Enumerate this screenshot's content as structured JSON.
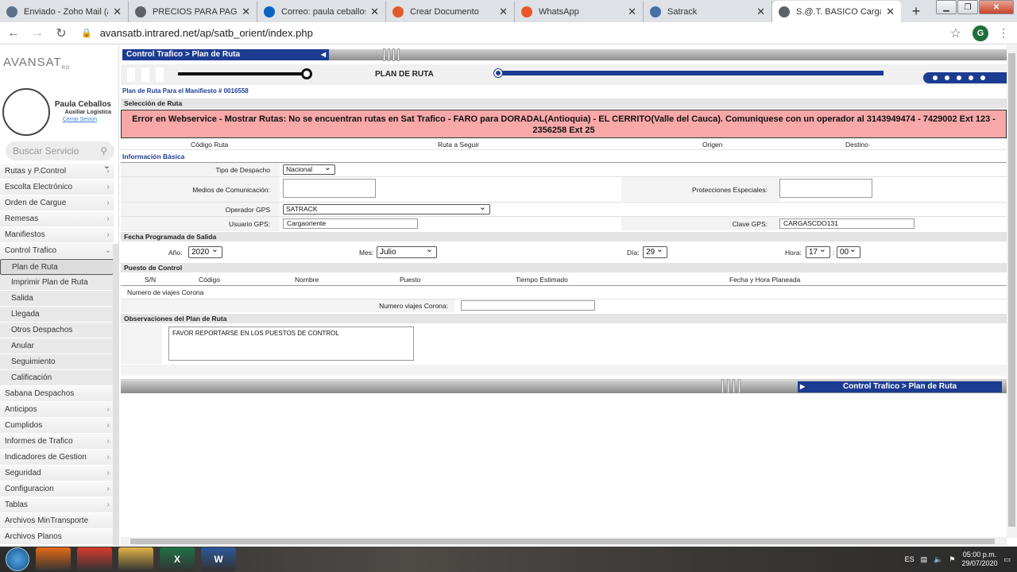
{
  "tabs": [
    {
      "title": "Enviado - Zoho Mail (aux",
      "icon": "zoho-mail-icon",
      "color": "#5b6f8a"
    },
    {
      "title": "PRECIOS PARA PAGAR A",
      "icon": "globe-icon",
      "color": "#5f6368"
    },
    {
      "title": "Correo: paula ceballos - C",
      "icon": "outlook-icon",
      "color": "#0a64c2"
    },
    {
      "title": "Crear Documento",
      "icon": "document-icon",
      "color": "#e25a2c"
    },
    {
      "title": "WhatsApp",
      "icon": "whatsapp-icon",
      "color": "#e8582a"
    },
    {
      "title": "Satrack",
      "icon": "satrack-icon",
      "color": "#4a6fa5"
    },
    {
      "title": "S.@.T. BASICO Cargas de",
      "icon": "globe-icon",
      "color": "#5f6368"
    }
  ],
  "address": {
    "url": "avansatb.intrared.net/ap/satb_orient/index.php",
    "account_initial": "G"
  },
  "sidebar": {
    "logo": "AVANSAT",
    "logo_sup": "RD",
    "user_name": "Paula Ceballos",
    "user_role": "Auxiliar Logistica",
    "logout": "Cerrar Sesion",
    "search_placeholder": "Buscar Servicio",
    "items": [
      {
        "label": "Rutas y P.Control",
        "type": "item",
        "chev": "›"
      },
      {
        "label": "Escolta Electrónico",
        "type": "item",
        "chev": "›"
      },
      {
        "label": "Orden de Cargue",
        "type": "item",
        "chev": "›"
      },
      {
        "label": "Remesas",
        "type": "item",
        "chev": "›"
      },
      {
        "label": "Manifiestos",
        "type": "item",
        "chev": "›"
      },
      {
        "label": "Control Trafico",
        "type": "item",
        "chev": "⌄"
      },
      {
        "label": "Plan de Ruta",
        "type": "sub",
        "chev": ""
      },
      {
        "label": "Imprimir Plan de Ruta",
        "type": "sub",
        "chev": ""
      },
      {
        "label": "Salida",
        "type": "sub",
        "chev": ""
      },
      {
        "label": "Llegada",
        "type": "sub",
        "chev": ""
      },
      {
        "label": "Otros Despachos",
        "type": "sub",
        "chev": ""
      },
      {
        "label": "Anular",
        "type": "sub",
        "chev": ""
      },
      {
        "label": "Seguimiento",
        "type": "sub",
        "chev": ""
      },
      {
        "label": "Calificación",
        "type": "sub",
        "chev": ""
      },
      {
        "label": "Sabana Despachos",
        "type": "item",
        "chev": ""
      },
      {
        "label": "Anticipos",
        "type": "item",
        "chev": "›"
      },
      {
        "label": "Cumplidos",
        "type": "item",
        "chev": "›"
      },
      {
        "label": "Informes de Trafico",
        "type": "item",
        "chev": "›"
      },
      {
        "label": "Indicadores de Gestion",
        "type": "item",
        "chev": "›"
      },
      {
        "label": "Seguridad",
        "type": "item",
        "chev": "›"
      },
      {
        "label": "Configuracion",
        "type": "item",
        "chev": "›"
      },
      {
        "label": "Tablas",
        "type": "item",
        "chev": "›"
      },
      {
        "label": "Archivos MinTransporte",
        "type": "item",
        "chev": ""
      },
      {
        "label": "Archivos Planos",
        "type": "item",
        "chev": ""
      }
    ]
  },
  "main": {
    "breadcrumb": "Control Trafico > Plan de Ruta",
    "page_title": "PLAN DE RUTA",
    "manifest": "Plan de Ruta Para el Manifiesto # 0016558",
    "sec_route": "Selección de Ruta",
    "error": "Error en Webservice - Mostrar Rutas: No se encuentran rutas en Sat Trafico - FARO para DORADAL(Antioquia) - EL CERRITO(Valle del Cauca). Comuniquese con un operador al 3143949474 - 7429002 Ext 123 - 2356258 Ext 25",
    "route_cols": [
      "Código Ruta",
      "Ruta a Seguir",
      "Origen",
      "Destino"
    ],
    "sec_info": "Información Básica",
    "tipo_label": "Tipo de Despacho",
    "tipo_value": "Nacional",
    "medios_label": "Medios de Comunicación:",
    "prot_label": "Protecciones Especiales:",
    "operador_label": "Operador GPS",
    "operador_value": "SATRACK",
    "usuario_label": "Usuario GPS:",
    "usuario_value": "Cargaoriente",
    "clave_label": "Clave GPS:",
    "clave_value": "CARGASCDO131",
    "sec_fecha": "Fecha Programada de Salida",
    "anio_label": "Año:",
    "anio_value": "2020",
    "mes_label": "Mes:",
    "mes_value": "Julio",
    "dia_label": "Día:",
    "dia_value": "29",
    "hora_label": "Hora:",
    "hora_value": "17",
    "min_value": "00",
    "sec_puesto": "Puesto de Control",
    "puesto_cols": [
      "S/N",
      "Código",
      "Nombre",
      "Puesto",
      "Tiempo Estimado",
      "Fecha y Hora Planeada"
    ],
    "viajes_title": "Numero de viajes Corona",
    "viajes_label": "Numero viajes Corona:",
    "sec_obs": "Observaciones del Plan de Ruta",
    "obs_value": "FAVOR REPORTARSE EN LOS PUESTOS DE CONTROL",
    "footer_btn": "Control Trafico > Plan de Ruta"
  },
  "taskbar": {
    "apps": [
      {
        "name": "firefox-icon",
        "color": "#e66a16",
        "label": ""
      },
      {
        "name": "chrome-icon",
        "color": "#d63b2b",
        "label": ""
      },
      {
        "name": "explorer-icon",
        "color": "#e3b448",
        "label": ""
      },
      {
        "name": "excel-icon",
        "color": "#1e7145",
        "label": "X"
      },
      {
        "name": "word-icon",
        "color": "#2b579a",
        "label": "W"
      }
    ],
    "lang": "ES",
    "time": "05:00 p.m.",
    "date": "29/07/2020"
  }
}
